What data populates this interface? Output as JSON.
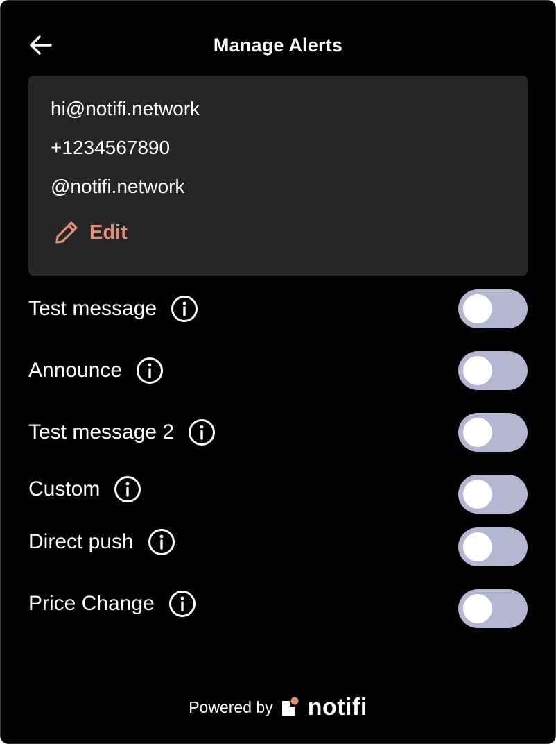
{
  "header": {
    "title": "Manage Alerts",
    "back_icon": "arrow-left-icon"
  },
  "contacts": {
    "email": "hi@notifi.network",
    "phone": "+1234567890",
    "telegram": "@notifi.network",
    "edit_label": "Edit",
    "edit_icon": "pencil-icon"
  },
  "alerts": [
    {
      "label": "Test message",
      "enabled": false
    },
    {
      "label": "Announce",
      "enabled": false
    },
    {
      "label": "Test message 2",
      "enabled": false
    },
    {
      "label": "Custom",
      "enabled": false
    },
    {
      "label": "Direct push",
      "enabled": false
    },
    {
      "label": "Price Change",
      "enabled": false
    }
  ],
  "footer": {
    "powered_by": "Powered by",
    "brand": "notifi"
  },
  "colors": {
    "background": "#000000",
    "card": "#262626",
    "accent": "#e38d76",
    "toggle_track": "#b4b6d2",
    "toggle_knob": "#ffffff",
    "text": "#ffffff"
  }
}
